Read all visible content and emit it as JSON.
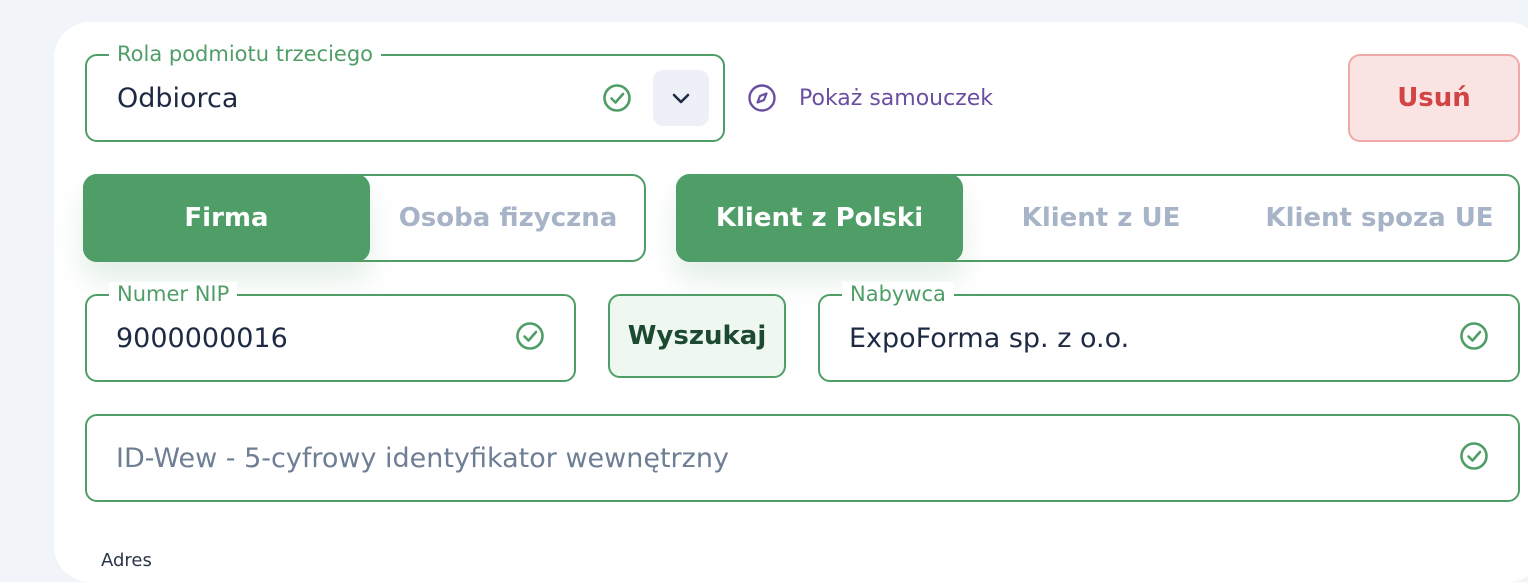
{
  "role_field": {
    "label": "Rola podmiotu trzeciego",
    "value": "Odbiorca",
    "status_icon": "check-circle-icon",
    "dropdown_icon": "chevron-down-icon"
  },
  "tutorial_link": {
    "label": "Pokaż samouczek",
    "icon": "compass-icon"
  },
  "delete_button": {
    "label": "Usuń"
  },
  "entity_type_toggle": {
    "options": [
      {
        "label": "Firma",
        "active": true
      },
      {
        "label": "Osoba fizyczna",
        "active": false
      }
    ]
  },
  "client_region_toggle": {
    "options": [
      {
        "label": "Klient z Polski",
        "active": true
      },
      {
        "label": "Klient z UE",
        "active": false
      },
      {
        "label": "Klient spoza UE",
        "active": false
      }
    ]
  },
  "nip_field": {
    "label": "Numer NIP",
    "value": "9000000016",
    "status_icon": "check-circle-icon"
  },
  "search_button": {
    "label": "Wyszukaj"
  },
  "buyer_field": {
    "label": "Nabywca",
    "value": "ExpoForma sp. z o.o.",
    "status_icon": "check-circle-icon"
  },
  "internal_id_field": {
    "placeholder": "ID-Wew - 5-cyfrowy identyfikator wewnętrzny",
    "value": "",
    "status_icon": "check-circle-icon"
  },
  "address_section": {
    "label": "Adres"
  },
  "colors": {
    "accent_green": "#4f9e67",
    "danger_red": "#d24343",
    "link_purple": "#6a4fa0",
    "inactive_text": "#a7b3c6"
  }
}
